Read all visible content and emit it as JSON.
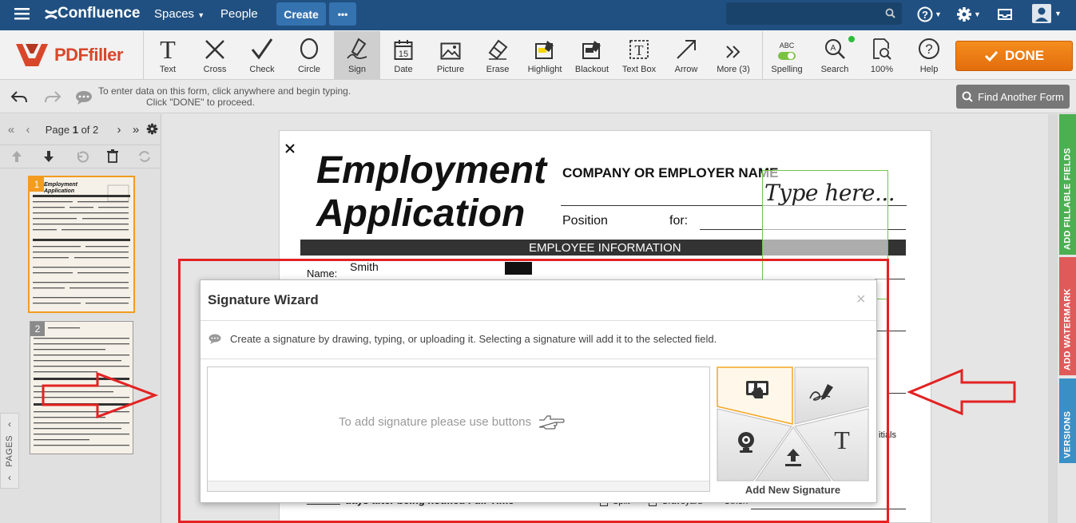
{
  "nav": {
    "brand": "Confluence",
    "spaces": "Spaces",
    "people": "People",
    "create": "Create",
    "more": "•••"
  },
  "logo": {
    "name": "PDFfiller"
  },
  "tools": [
    {
      "label": "Text",
      "icon": "text-icon"
    },
    {
      "label": "Cross",
      "icon": "cross-icon"
    },
    {
      "label": "Check",
      "icon": "check-icon"
    },
    {
      "label": "Circle",
      "icon": "circle-icon"
    },
    {
      "label": "Sign",
      "icon": "sign-icon",
      "active": true
    },
    {
      "label": "Date",
      "icon": "calendar-icon",
      "day": "15"
    },
    {
      "label": "Picture",
      "icon": "picture-icon"
    },
    {
      "label": "Erase",
      "icon": "eraser-icon"
    },
    {
      "label": "Highlight",
      "icon": "highlight-icon"
    },
    {
      "label": "Blackout",
      "icon": "blackout-icon"
    },
    {
      "label": "Text Box",
      "icon": "textbox-icon"
    },
    {
      "label": "Arrow",
      "icon": "arrow-icon"
    },
    {
      "label": "More (3)",
      "icon": "more-icon"
    }
  ],
  "tools_right": [
    {
      "label": "Spelling",
      "icon": "spelling-icon",
      "badge": "ABC"
    },
    {
      "label": "Search",
      "icon": "search-icon"
    },
    {
      "label": "100%",
      "icon": "zoom-icon"
    },
    {
      "label": "Help",
      "icon": "help-icon"
    }
  ],
  "done": "DONE",
  "info": {
    "line1": "To enter data on this form, click anywhere and begin typing.",
    "line2": "Click \"DONE\" to proceed."
  },
  "find_form": "Find Another Form",
  "pager": {
    "prefix": "Page ",
    "current": "1",
    "sep": " of ",
    "total": "2"
  },
  "thumbs": [
    {
      "num": "1"
    },
    {
      "num": "2"
    }
  ],
  "pages_label": "PAGES",
  "doc": {
    "title1": "Employment",
    "title2": "Application",
    "company": "COMPANY OR EMPLOYER NAME",
    "position": "Position",
    "for": "for:",
    "section": "EMPLOYEE INFORMATION",
    "name_label": "Name:",
    "name_value": "Smith",
    "type_here": "Type here...",
    "bottom_text": "days after being notified Full-Time",
    "split": "Split",
    "graveyard": "Graveyard",
    "other": "Other:",
    "initials": "itials"
  },
  "right_tabs": [
    {
      "label": "ADD FILLABLE FIELDS",
      "color": "#4caf50"
    },
    {
      "label": "ADD WATERMARK",
      "color": "#e05a5a"
    },
    {
      "label": "VERSIONS",
      "color": "#3a8fc4"
    }
  ],
  "modal": {
    "title": "Signature Wizard",
    "close": "×",
    "description": "Create a signature by drawing, typing, or uploading it. Selecting a signature will add it to the selected field.",
    "hint": "To add signature please use buttons",
    "add_new": "Add New Signature",
    "options": [
      {
        "name": "draw-touch",
        "icon": "touch-draw-icon"
      },
      {
        "name": "draw-pen",
        "icon": "pen-signature-icon"
      },
      {
        "name": "webcam",
        "icon": "webcam-icon"
      },
      {
        "name": "upload",
        "icon": "upload-icon"
      },
      {
        "name": "type",
        "icon": "type-text-icon",
        "glyph": "T"
      }
    ]
  },
  "colors": {
    "nav": "#205081",
    "done": "#e87a13",
    "annotation_red": "#e32222",
    "selected_orange": "#f5a623"
  }
}
